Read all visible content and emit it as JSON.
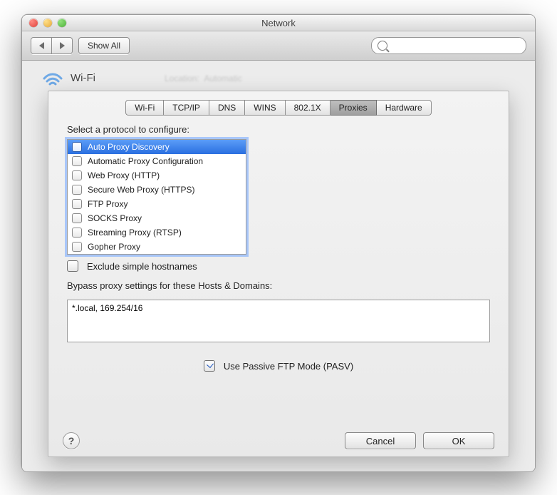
{
  "window": {
    "title": "Network"
  },
  "toolbar": {
    "show_all": "Show All",
    "search_placeholder": ""
  },
  "pane": {
    "title": "Wi-Fi",
    "tabs": [
      "Wi-Fi",
      "TCP/IP",
      "DNS",
      "WINS",
      "802.1X",
      "Proxies",
      "Hardware"
    ],
    "selected_tab_index": 5,
    "select_protocol_label": "Select a protocol to configure:",
    "protocols": [
      {
        "label": "Auto Proxy Discovery",
        "checked": false,
        "selected": true
      },
      {
        "label": "Automatic Proxy Configuration",
        "checked": false,
        "selected": false
      },
      {
        "label": "Web Proxy (HTTP)",
        "checked": false,
        "selected": false
      },
      {
        "label": "Secure Web Proxy (HTTPS)",
        "checked": false,
        "selected": false
      },
      {
        "label": "FTP Proxy",
        "checked": false,
        "selected": false
      },
      {
        "label": "SOCKS Proxy",
        "checked": false,
        "selected": false
      },
      {
        "label": "Streaming Proxy (RTSP)",
        "checked": false,
        "selected": false
      },
      {
        "label": "Gopher Proxy",
        "checked": false,
        "selected": false
      }
    ],
    "exclude_simple_label": "Exclude simple hostnames",
    "exclude_simple_checked": false,
    "bypass_label": "Bypass proxy settings for these Hosts & Domains:",
    "bypass_value": "*.local, 169.254/16",
    "pasv_label": "Use Passive FTP Mode (PASV)",
    "pasv_checked": true,
    "cancel": "Cancel",
    "ok": "OK",
    "help": "?"
  }
}
